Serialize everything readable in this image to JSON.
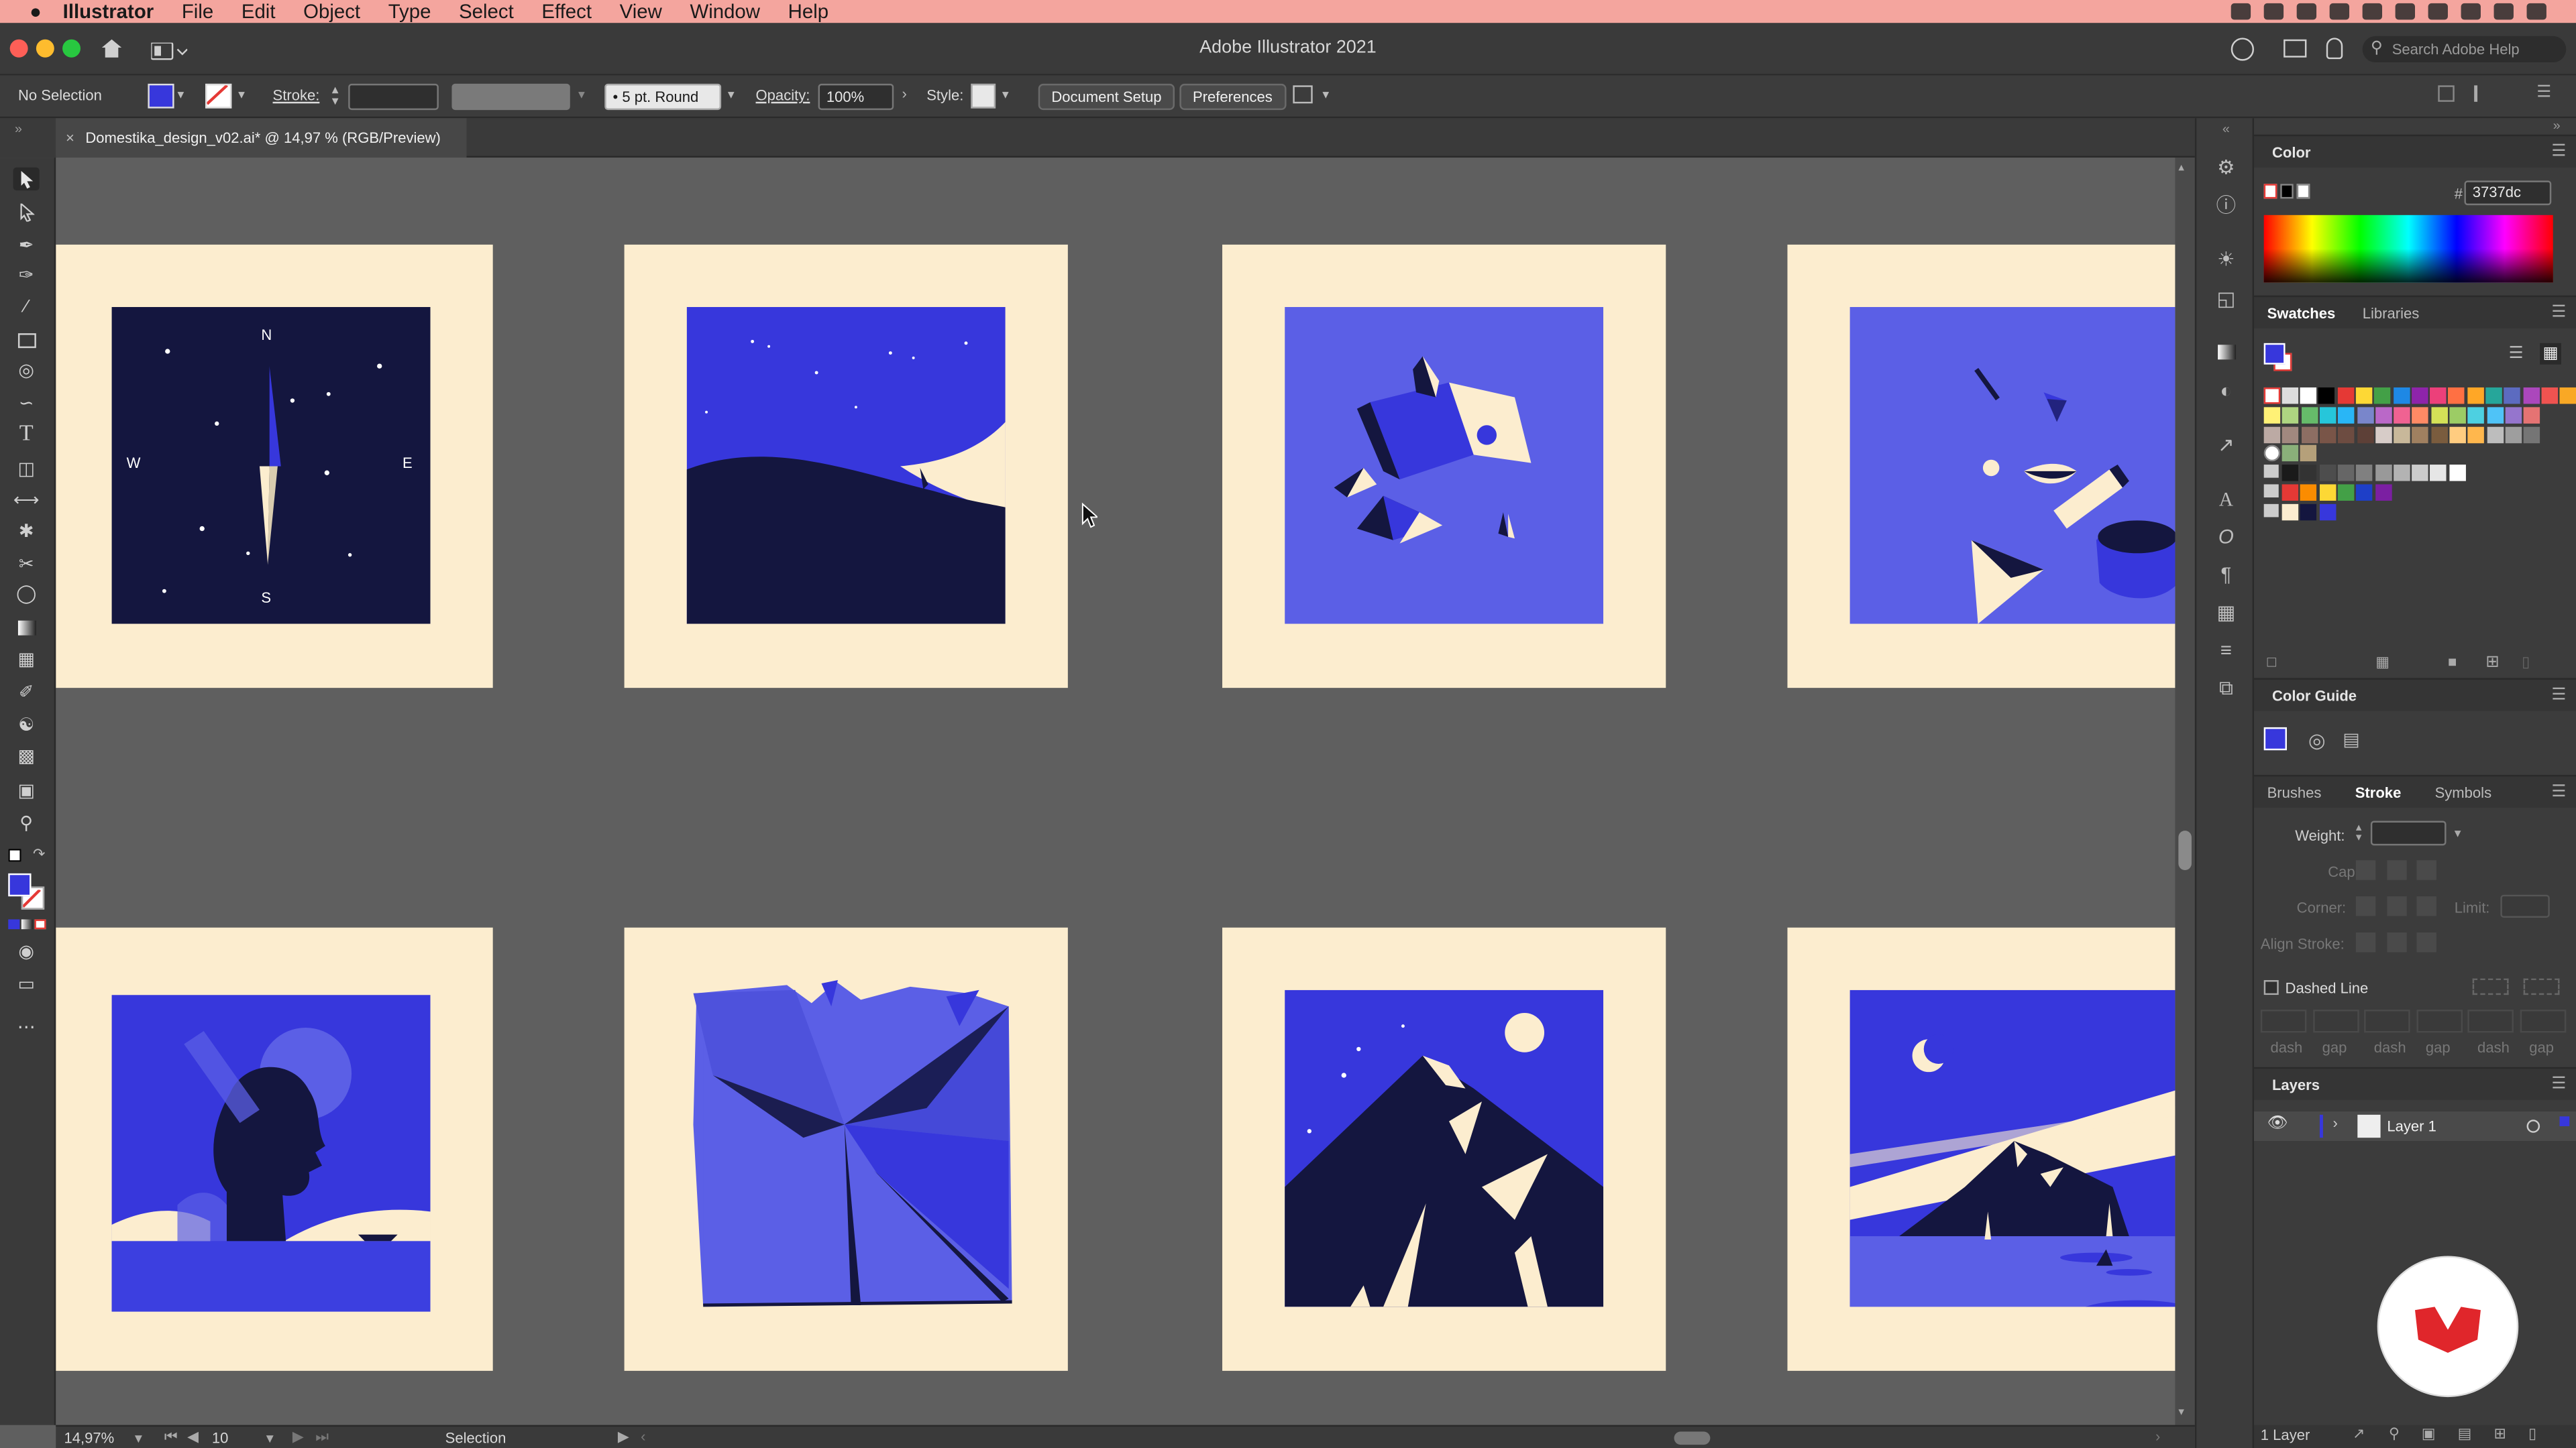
{
  "menubar": {
    "app": "Illustrator",
    "items": [
      "File",
      "Edit",
      "Object",
      "Type",
      "Select",
      "Effect",
      "View",
      "Window",
      "Help"
    ]
  },
  "titlebar": {
    "title": "Adobe Illustrator 2021",
    "search_placeholder": "Search Adobe Help"
  },
  "control": {
    "selection": "No Selection",
    "stroke_label": "Stroke:",
    "brush": "5 pt. Round",
    "opacity_label": "Opacity:",
    "opacity": "100%",
    "style_label": "Style:",
    "document_setup": "Document Setup",
    "preferences": "Preferences"
  },
  "document_tab": {
    "name": "Domestika_design_v02.ai* @ 14,97 % (RGB/Preview)"
  },
  "artboards": [
    {
      "label": "compass",
      "directions": [
        "N",
        "E",
        "S",
        "W"
      ]
    },
    {
      "label": "night-wave"
    },
    {
      "label": "floating-shapes-1"
    },
    {
      "label": "floating-shapes-2"
    },
    {
      "label": "head-profile"
    },
    {
      "label": "folded-paper"
    },
    {
      "label": "mountain-moon"
    },
    {
      "label": "island-moon"
    }
  ],
  "color_panel": {
    "title": "Color",
    "hex_label": "#",
    "hex": "3737dc"
  },
  "swatches_panel": {
    "tabs": [
      "Swatches",
      "Libraries"
    ],
    "row1": [
      "#ffffff",
      "#000000",
      "#e53935",
      "#fdd835",
      "#43a047",
      "#1e88e5",
      "#8e24aa",
      "#ec407a",
      "#ff7043",
      "#ffa726",
      "#26a69a",
      "#5c6bc0",
      "#ab47bc",
      "#ef5350",
      "#f9a825"
    ],
    "row2": [
      "#fff176",
      "#aed581",
      "#66bb6a",
      "#26c6da",
      "#29b6f6",
      "#7986cb",
      "#ba68c8",
      "#f06292",
      "#ff8a65",
      "#d4e157",
      "#9ccc65",
      "#4dd0e1",
      "#4fc3f7",
      "#9575cd",
      "#e57373"
    ],
    "row3": [
      "#bcaaa4",
      "#a1887f",
      "#8d6e63",
      "#795548",
      "#6d4c41",
      "#5d4037",
      "#d7ccc8",
      "#c8b89a",
      "#a08060",
      "#7a5c3e",
      "#ffcc80",
      "#ffb74d",
      "#bdbdbd",
      "#9e9e9e",
      "#757575"
    ],
    "gray_row": [
      "#1a1a1a",
      "#333333",
      "#4d4d4d",
      "#666666",
      "#808080",
      "#999999",
      "#b3b3b3",
      "#cccccc",
      "#e6e6e6",
      "#ffffff"
    ],
    "group1": [
      "#e53935",
      "#fb8c00",
      "#fdd835",
      "#43a047",
      "#1e3fc8",
      "#7b1fa2"
    ],
    "group2": [
      "#fcedcf",
      "#14163f",
      "#3737dc"
    ]
  },
  "color_guide": {
    "title": "Color Guide"
  },
  "stroke_panel": {
    "tabs": [
      "Brushes",
      "Stroke",
      "Symbols"
    ],
    "weight_label": "Weight:",
    "cap_label": "Cap:",
    "corner_label": "Corner:",
    "limit_label": "Limit:",
    "align_label": "Align Stroke:",
    "dashed_line": "Dashed Line",
    "dash_labels": [
      "dash",
      "gap",
      "dash",
      "gap",
      "dash",
      "gap"
    ]
  },
  "layers_panel": {
    "title": "Layers",
    "layer_name": "Layer 1",
    "count": "1 Layer"
  },
  "statusbar": {
    "zoom": "14,97%",
    "artboard_number": "10",
    "tool": "Selection"
  },
  "colors": {
    "accent_blue": "#3737dc",
    "periwinkle": "#5b5fe6",
    "navy": "#14163f",
    "cream": "#fcedcf",
    "menubar": "#f4a59e",
    "domestika_red": "#e0262b"
  }
}
